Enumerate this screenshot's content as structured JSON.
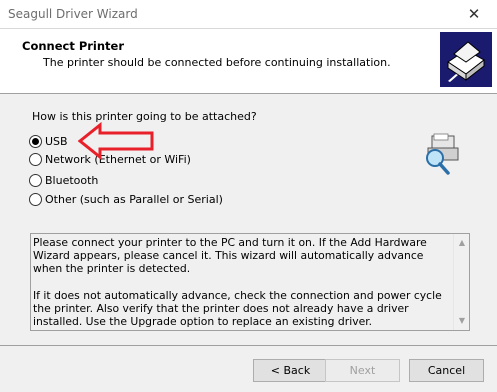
{
  "window": {
    "title": "Seagull Driver Wizard",
    "close_label": "✕"
  },
  "header": {
    "title": "Connect Printer",
    "subtitle": "The printer should be connected before continuing installation."
  },
  "question": "How is this printer going to be attached?",
  "options": [
    {
      "label": "USB",
      "checked": true
    },
    {
      "label": "Network (Ethernet or WiFi)",
      "checked": false
    },
    {
      "label": "Bluetooth",
      "checked": false
    },
    {
      "label": "Other (such as Parallel or Serial)",
      "checked": false
    }
  ],
  "info": {
    "paragraph1": "Please connect your printer to the PC and turn it on. If the Add Hardware Wizard appears, please cancel it. This wizard will automatically advance when the printer is detected.",
    "paragraph2": "If it does not automatically advance, check the connection and power cycle the printer.  Also verify that the printer does not already have a driver installed.  Use the Upgrade option to replace an existing driver."
  },
  "buttons": {
    "back": "< Back",
    "next": "Next",
    "cancel": "Cancel"
  },
  "colors": {
    "arrow": "#e8202a",
    "logo_bg": "#1a1a6e"
  }
}
